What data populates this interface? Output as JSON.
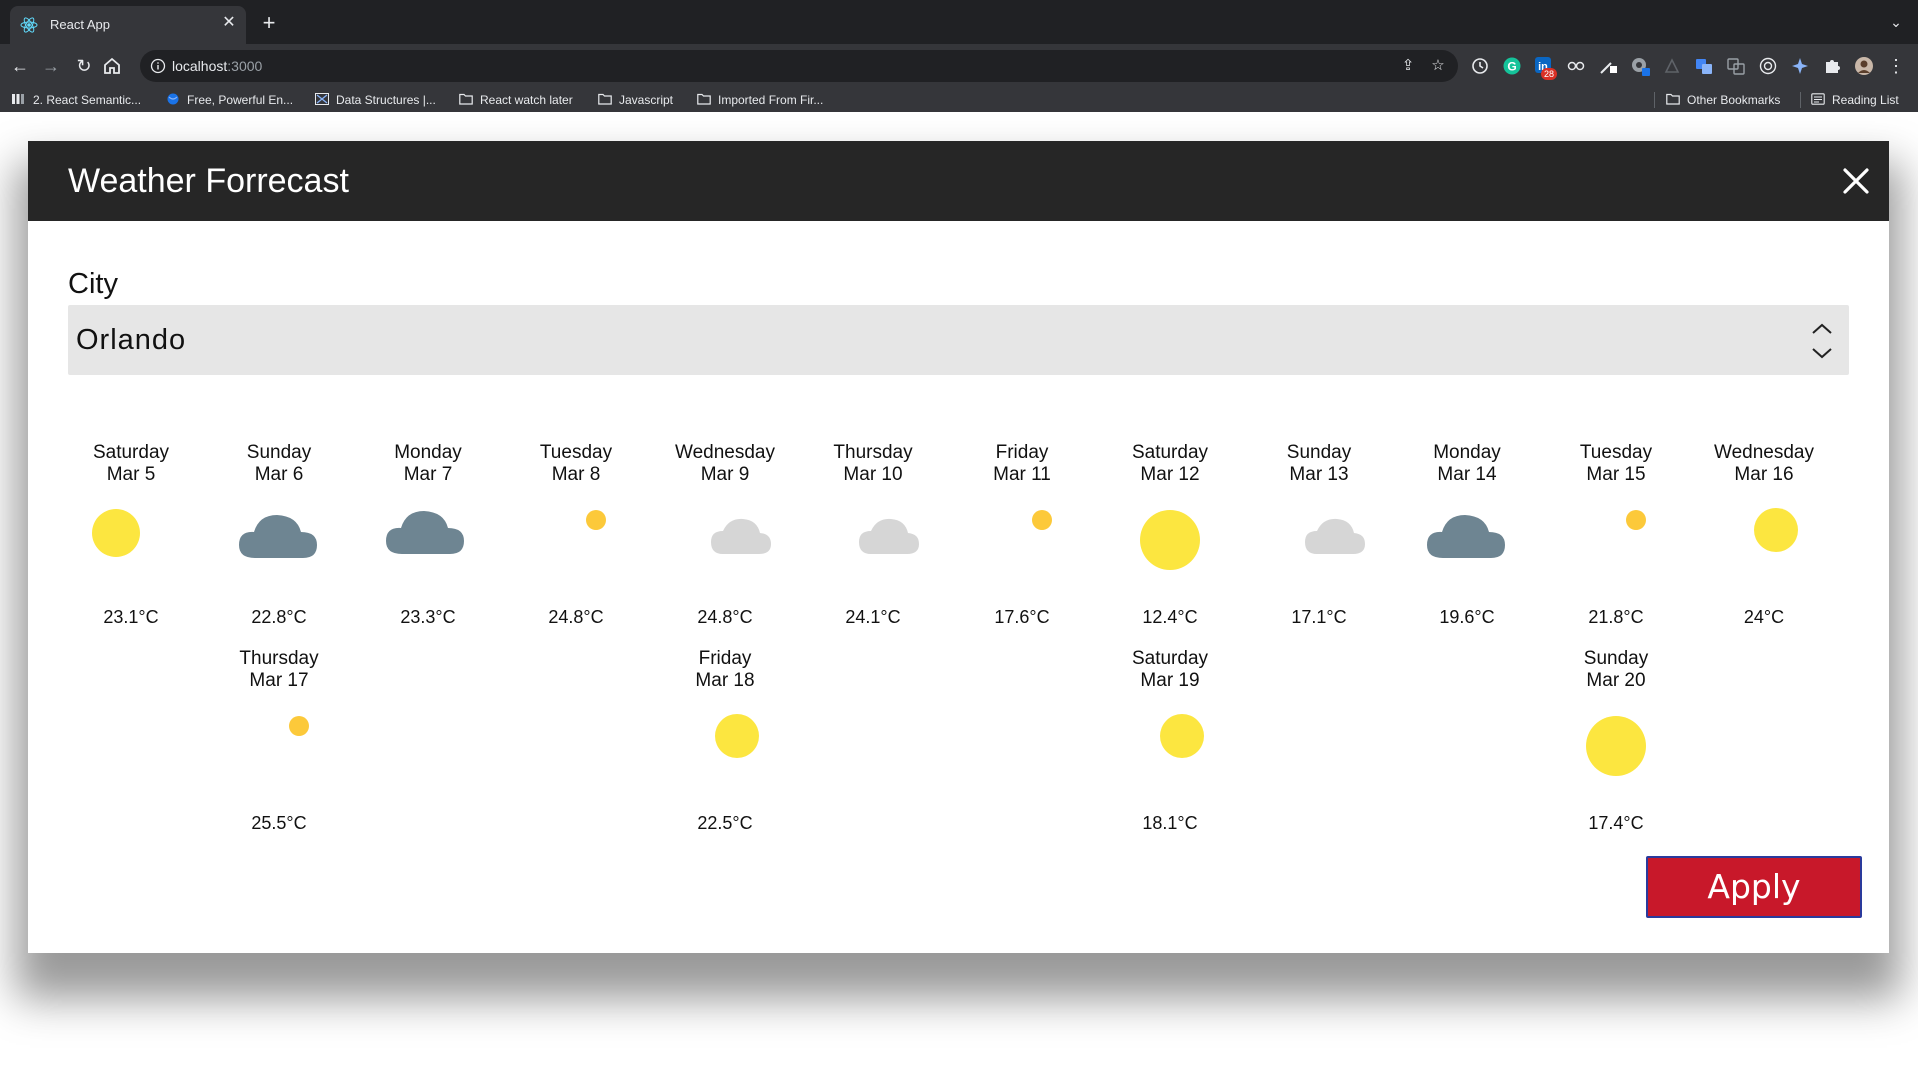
{
  "browser": {
    "tab_title": "React App",
    "url_host": "localhost",
    "url_port": ":3000",
    "extension_badge": "28",
    "bookmarks": [
      {
        "label": "2. React Semantic...",
        "icon": "react-semantic-icon"
      },
      {
        "label": "Free, Powerful En...",
        "icon": "globe-icon"
      },
      {
        "label": "Data Structures |...",
        "icon": "data-structures-icon"
      },
      {
        "label": "React watch later",
        "icon": "folder-icon"
      },
      {
        "label": "Javascript",
        "icon": "folder-icon"
      },
      {
        "label": "Imported From Fir...",
        "icon": "folder-icon"
      }
    ],
    "other_bookmarks": "Other Bookmarks",
    "reading_list": "Reading List"
  },
  "modal": {
    "title": "Weather Forrecast",
    "city_label": "City",
    "city_value": "Orlando",
    "apply_label": "Apply"
  },
  "forecast": [
    {
      "day": "Saturday",
      "date": "Mar 5",
      "temp": "23.1°C",
      "icon": "partly-cloudy-icon"
    },
    {
      "day": "Sunday",
      "date": "Mar 6",
      "temp": "22.8°C",
      "icon": "rain-icon"
    },
    {
      "day": "Monday",
      "date": "Mar 7",
      "temp": "23.3°C",
      "icon": "wind-rain-icon"
    },
    {
      "day": "Tuesday",
      "date": "Mar 8",
      "temp": "24.8°C",
      "icon": "thunderstorm-sun-icon"
    },
    {
      "day": "Wednesday",
      "date": "Mar 9",
      "temp": "24.8°C",
      "icon": "cloudy-icon"
    },
    {
      "day": "Thursday",
      "date": "Mar 10",
      "temp": "24.1°C",
      "icon": "cloudy-icon"
    },
    {
      "day": "Friday",
      "date": "Mar 11",
      "temp": "17.6°C",
      "icon": "thunderstorm-sun-icon"
    },
    {
      "day": "Saturday",
      "date": "Mar 12",
      "temp": "12.4°C",
      "icon": "sun-icon"
    },
    {
      "day": "Sunday",
      "date": "Mar 13",
      "temp": "17.1°C",
      "icon": "cloudy-icon"
    },
    {
      "day": "Monday",
      "date": "Mar 14",
      "temp": "19.6°C",
      "icon": "rain-icon"
    },
    {
      "day": "Tuesday",
      "date": "Mar 15",
      "temp": "21.8°C",
      "icon": "thunderstorm-sun-icon"
    },
    {
      "day": "Wednesday",
      "date": "Mar 16",
      "temp": "24°C",
      "icon": "mostly-cloudy-icon"
    },
    {
      "day": "Thursday",
      "date": "Mar 17",
      "temp": "25.5°C",
      "icon": "thunderstorm-sun-icon"
    },
    {
      "day": "Friday",
      "date": "Mar 18",
      "temp": "22.5°C",
      "icon": "mostly-cloudy-icon"
    },
    {
      "day": "Saturday",
      "date": "Mar 19",
      "temp": "18.1°C",
      "icon": "mostly-cloudy-icon"
    },
    {
      "day": "Sunday",
      "date": "Mar 20",
      "temp": "17.4°C",
      "icon": "sun-icon"
    }
  ]
}
